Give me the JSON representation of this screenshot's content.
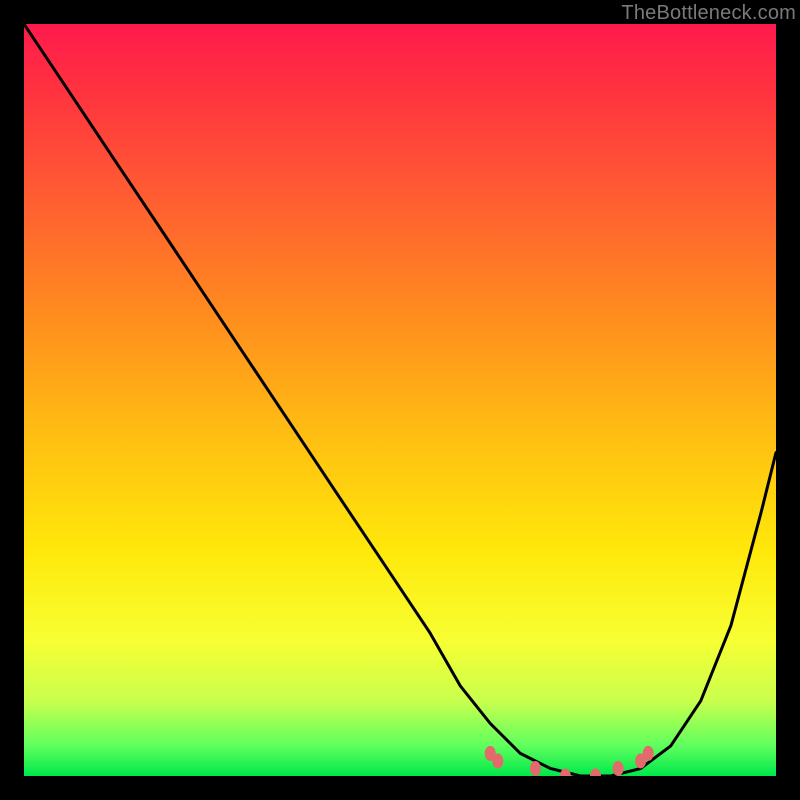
{
  "watermark": "TheBottleneck.com",
  "colors": {
    "background": "#000000",
    "gradient_top": "#ff1a4d",
    "gradient_mid": "#ffe80a",
    "gradient_bottom": "#00e84a",
    "curve": "#000000",
    "marker": "#e26a6a"
  },
  "chart_data": {
    "type": "line",
    "title": "",
    "xlabel": "",
    "ylabel": "",
    "xlim": [
      0,
      100
    ],
    "ylim": [
      0,
      100
    ],
    "grid": false,
    "legend": false,
    "series": [
      {
        "name": "bottleneck-curve",
        "x": [
          0,
          6,
          12,
          18,
          24,
          30,
          36,
          42,
          48,
          54,
          58,
          62,
          66,
          70,
          74,
          78,
          82,
          86,
          90,
          94,
          98,
          100
        ],
        "y": [
          100,
          91,
          82,
          73,
          64,
          55,
          46,
          37,
          28,
          19,
          12,
          7,
          3,
          1,
          0,
          0,
          1,
          4,
          10,
          20,
          35,
          43
        ]
      }
    ],
    "markers": [
      {
        "name": "flat-start-a",
        "x": 62,
        "y": 3
      },
      {
        "name": "flat-start-b",
        "x": 63,
        "y": 2
      },
      {
        "name": "flat-mid-a",
        "x": 68,
        "y": 1
      },
      {
        "name": "flat-mid-b",
        "x": 72,
        "y": 0
      },
      {
        "name": "flat-mid-c",
        "x": 76,
        "y": 0
      },
      {
        "name": "flat-mid-d",
        "x": 79,
        "y": 1
      },
      {
        "name": "flat-end-a",
        "x": 82,
        "y": 2
      },
      {
        "name": "flat-end-b",
        "x": 83,
        "y": 3
      }
    ]
  }
}
